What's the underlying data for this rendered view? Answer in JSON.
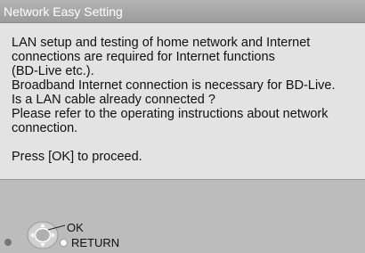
{
  "window": {
    "title": "Network Easy Setting"
  },
  "dialog": {
    "lines": [
      "LAN setup and testing of home network and Internet",
      "connections are required for Internet functions",
      "(BD-Live etc.).",
      "Broadband Internet connection is necessary for BD-Live.",
      "Is a LAN cable already connected ?",
      "Please refer to the operating instructions about network",
      "connection."
    ],
    "prompt": "Press [OK] to proceed."
  },
  "controls": {
    "ok_label": "OK",
    "return_label": "RETURN",
    "icons": [
      "dpad-ok-icon",
      "return-button-icon",
      "red-button-icon"
    ]
  }
}
